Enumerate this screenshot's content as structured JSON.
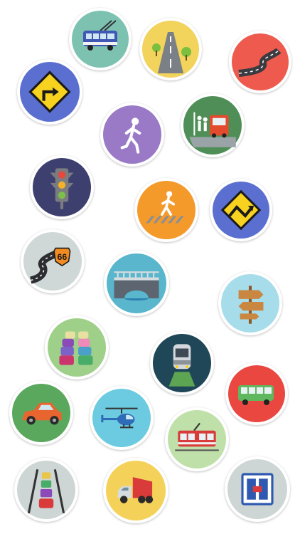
{
  "icons": [
    {
      "name": "trolleybus-icon",
      "bg": "#7dc2b1"
    },
    {
      "name": "straight-road-icon",
      "bg": "#f2d35b"
    },
    {
      "name": "winding-road-icon",
      "bg": "#ef5a4e"
    },
    {
      "name": "turn-right-sign-icon",
      "bg": "#5a6fcf"
    },
    {
      "name": "pedestrian-icon",
      "bg": "#9a7ac7"
    },
    {
      "name": "bus-stop-icon",
      "bg": "#4f8f57"
    },
    {
      "name": "traffic-light-icon",
      "bg": "#3d3f6e"
    },
    {
      "name": "crosswalk-icon",
      "bg": "#f39a2a"
    },
    {
      "name": "curvy-road-sign-icon",
      "bg": "#5a6fcf"
    },
    {
      "name": "route-66-icon",
      "bg": "#cfd8d6"
    },
    {
      "name": "bridge-icon",
      "bg": "#59b6cc"
    },
    {
      "name": "signpost-icon",
      "bg": "#a7dcea"
    },
    {
      "name": "traffic-jam-icon",
      "bg": "#9fd08a"
    },
    {
      "name": "train-icon",
      "bg": "#1f4758"
    },
    {
      "name": "bus-icon",
      "bg": "#e9473f"
    },
    {
      "name": "car-icon",
      "bg": "#5aa85e"
    },
    {
      "name": "helicopter-icon",
      "bg": "#6ccbe0"
    },
    {
      "name": "tram-icon",
      "bg": "#bfe0a8"
    },
    {
      "name": "highway-traffic-icon",
      "bg": "#cdd6d4"
    },
    {
      "name": "truck-icon",
      "bg": "#f4d25a"
    },
    {
      "name": "parking-sign-icon",
      "bg": "#cdd6d4"
    }
  ]
}
